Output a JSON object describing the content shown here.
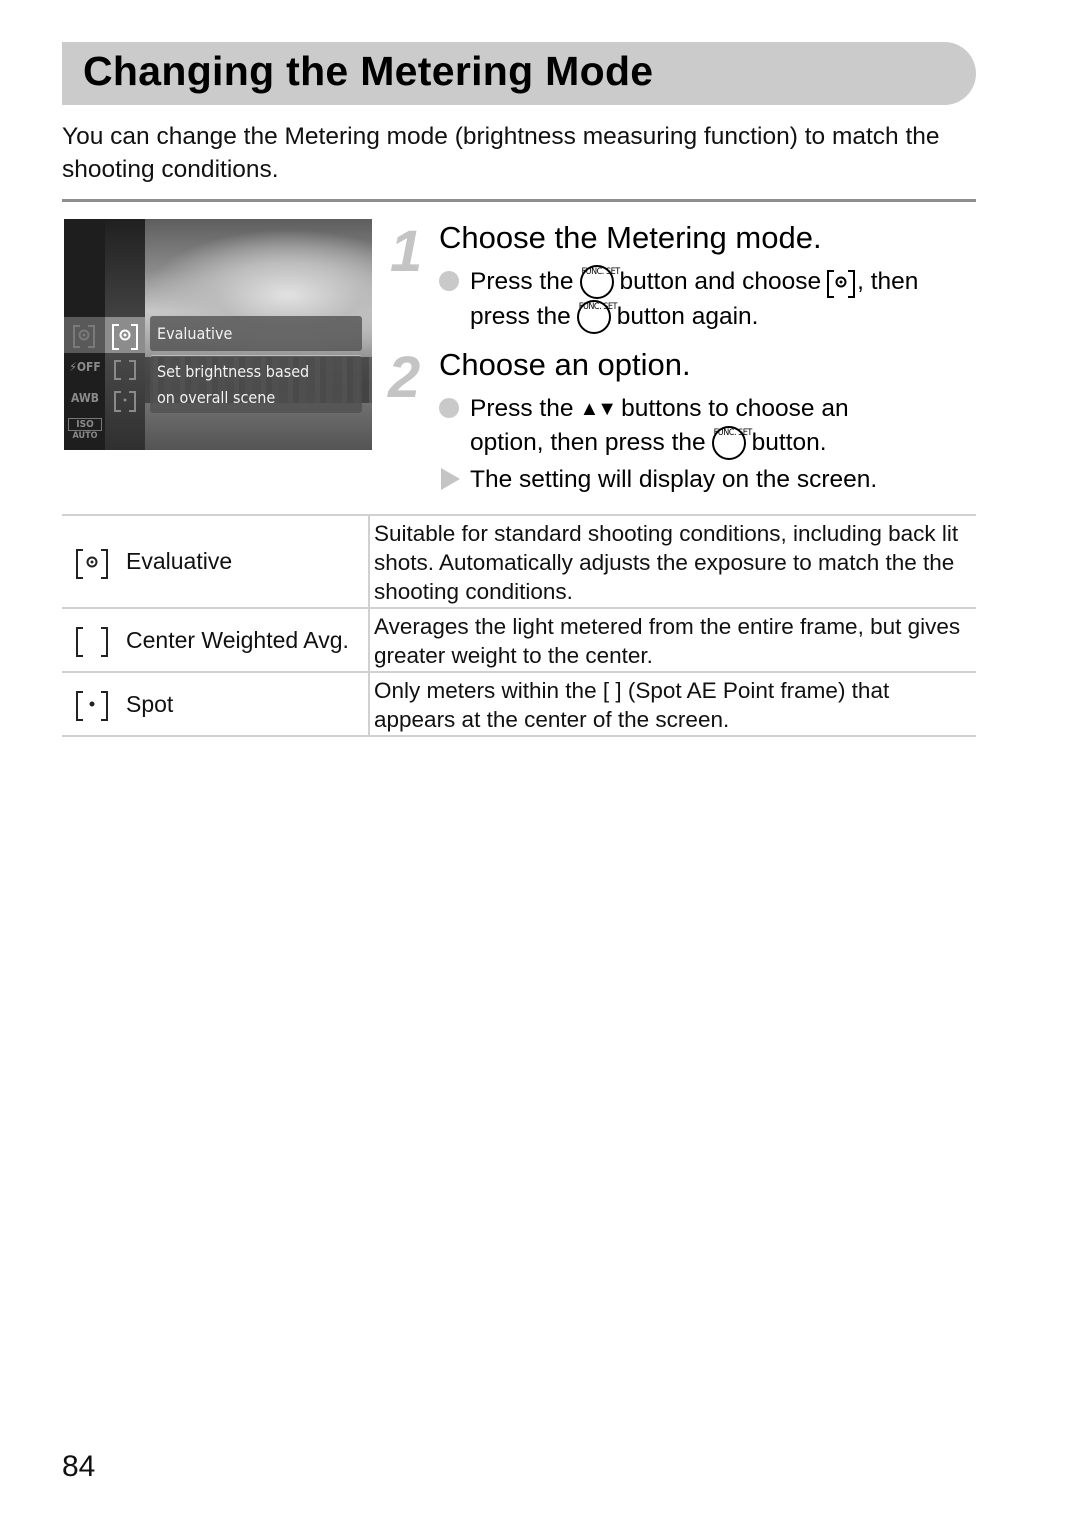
{
  "page": {
    "title": "Changing the Metering Mode",
    "intro": "You can change the Metering mode (brightness measuring function) to match the shooting conditions.",
    "page_number": "84"
  },
  "camera_screen": {
    "left_column_icons": [
      "metering-icon",
      "flash-off-icon",
      "awb-icon",
      "iso-auto-icon"
    ],
    "left_column_labels": {
      "flash": "⚡OFF",
      "awb": "AWB",
      "iso": "ISO",
      "iso_sub": "AUTO"
    },
    "option_icons": [
      "evaluative-icon",
      "center-weighted-icon",
      "spot-icon"
    ],
    "selected_option": "Evaluative",
    "description_line1": "Set brightness based",
    "description_line2": "on overall scene"
  },
  "steps": [
    {
      "number": "1",
      "title": "Choose the Metering mode.",
      "bullets": [
        {
          "type": "circle",
          "line1": {
            "before": "Press the",
            "icon1": "func-set-button",
            "middle": "button and choose",
            "icon2": "evaluative-icon",
            "after": ", then"
          },
          "line2": {
            "before": "press the",
            "icon": "func-set-button",
            "after": "button again."
          }
        }
      ]
    },
    {
      "number": "2",
      "title": "Choose an option.",
      "bullets": [
        {
          "type": "circle",
          "line1": {
            "before": "Press the",
            "icon": "up-down-arrows",
            "after": "buttons to choose an"
          },
          "line2": {
            "before": "option, then press the",
            "icon": "func-set-button",
            "after": "button."
          }
        },
        {
          "type": "triangle",
          "text": "The setting will display on the screen."
        }
      ]
    }
  ],
  "func_label": {
    "top": "FUNC.",
    "bottom": "SET"
  },
  "arrows_glyph": "▲▼",
  "table": {
    "rows": [
      {
        "icon": "evaluative-icon",
        "name": "Evaluative",
        "description": "Suitable for standard shooting conditions, including back lit shots. Automatically adjusts the exposure to match the the shooting conditions."
      },
      {
        "icon": "center-weighted-icon",
        "name": "Center Weighted Avg.",
        "description": "Averages the light metered from the entire frame, but gives greater weight to the center."
      },
      {
        "icon": "spot-icon",
        "name": "Spot",
        "description": "Only meters within the [  ] (Spot AE Point frame) that appears at the center of the screen."
      }
    ]
  }
}
